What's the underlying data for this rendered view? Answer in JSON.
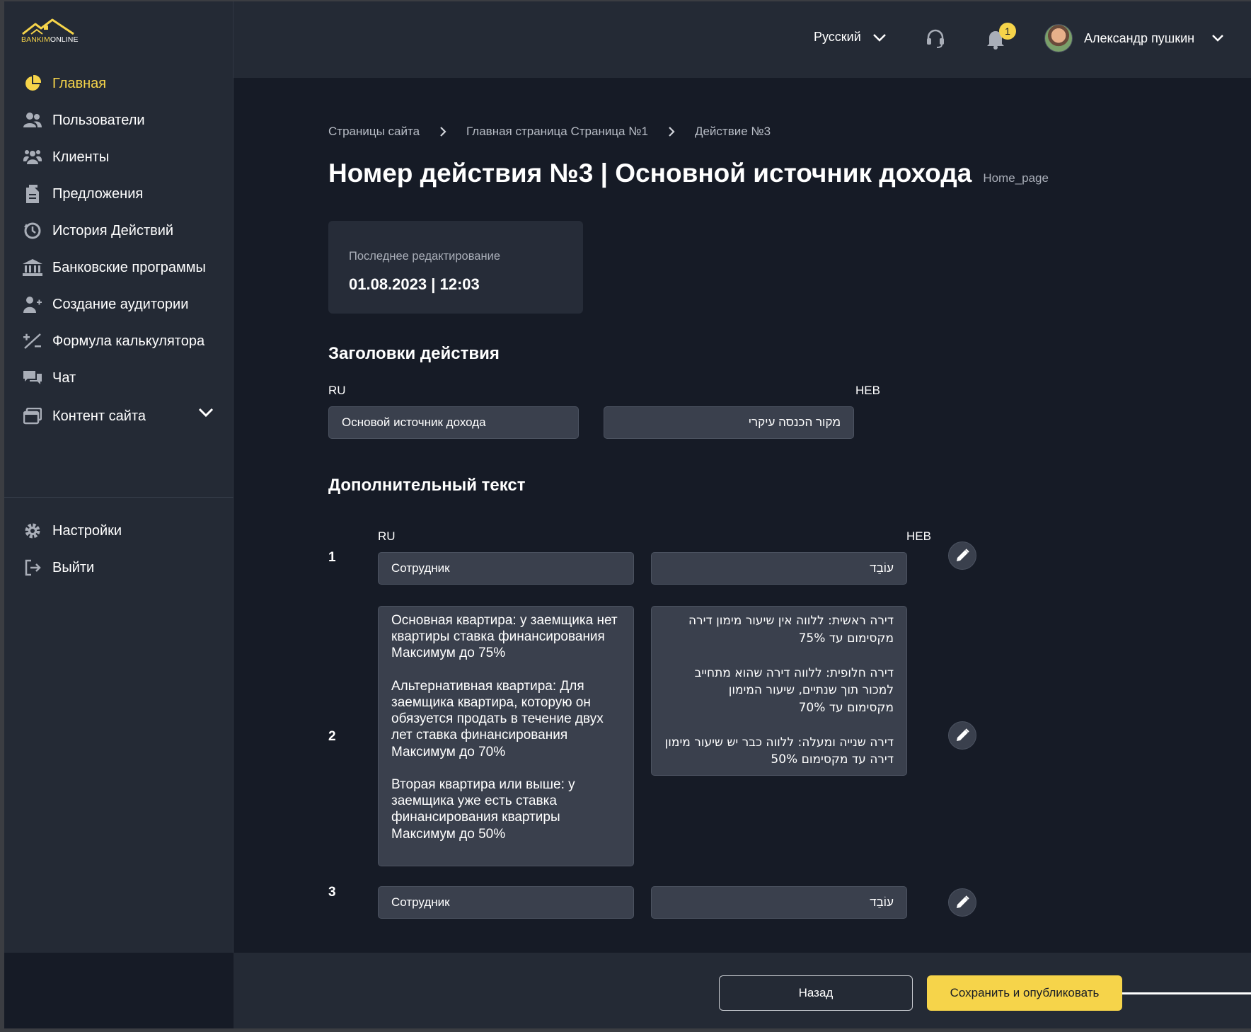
{
  "brand": {
    "logo_text_a": "BANKIM",
    "logo_text_b": "ONLINE"
  },
  "sidebar": {
    "items": [
      {
        "label": "Главная",
        "icon": "pie-chart-icon",
        "active": true
      },
      {
        "label": "Пользователи",
        "icon": "users-icon"
      },
      {
        "label": "Клиенты",
        "icon": "clients-icon"
      },
      {
        "label": "Предложения",
        "icon": "document-icon"
      },
      {
        "label": "История Действий",
        "icon": "history-icon"
      },
      {
        "label": "Банковские программы",
        "icon": "bank-icon"
      },
      {
        "label": "Создание аудитории",
        "icon": "add-user-icon"
      },
      {
        "label": "Формула калькулятора",
        "icon": "formula-icon"
      },
      {
        "label": "Чат",
        "icon": "chat-icon"
      },
      {
        "label": "Контент сайта",
        "icon": "content-icon"
      }
    ],
    "bottom": [
      {
        "label": "Настройки",
        "icon": "gear-icon"
      },
      {
        "label": "Выйти",
        "icon": "logout-icon"
      }
    ]
  },
  "topbar": {
    "language": "Русский",
    "notifications_count": "1",
    "user_name": "Александр пушкин"
  },
  "breadcrumb": [
    "Страницы сайта",
    "Главная страница Страница  №1",
    "Действие №3"
  ],
  "page": {
    "title": "Номер действия №3 | Основной источник дохода",
    "slug": "Home_page"
  },
  "last_edit": {
    "caption": "Последнее редактирование",
    "value": "01.08.2023 | 12:03"
  },
  "headings_section": {
    "title": "Заголовки действия",
    "ru_label": "RU",
    "heb_label": "HEB",
    "ru_value": "Основой источник дохода",
    "heb_value": "מקור הכנסה עיקרי"
  },
  "extra_section": {
    "title": "Дополнительный  текст",
    "ru_label": "RU",
    "heb_label": "HEB",
    "rows": [
      {
        "num": "1",
        "ru": "Сотрудник",
        "heb": "עוֹבֵד"
      },
      {
        "num": "2",
        "ru": "Основная квартира: у заемщика нет квартиры ставка финансирования\nМаксимум до 75%\n\nАльтернативная квартира: Для заемщика квартира, которую он обязуется продать в течение двух лет ставка финансирования\nМаксимум до 70%\n\nВторая квартира или выше: у заемщика уже есть ставка финансирования квартиры\nМаксимум до 50%",
        "heb": "דירה ראשית: ללווה אין שיעור מימון דירה\nמקסימום עד 75%\n\nדירה חלופית: ללווה דירה שהוא מתחייב\nלמכור תוך שנתיים, שיעור המימון\nמקסימום עד 70%\n\nדירה שנייה ומעלה: ללווה כבר יש שיעור מימון\nדירה עד מקסימום 50%"
      },
      {
        "num": "3",
        "ru": "Сотрудник",
        "heb": "עוֹבֵד"
      }
    ]
  },
  "footer": {
    "back_label": "Назад",
    "save_label": "Сохранить и опубликовать"
  },
  "colors": {
    "accent": "#f6d44a",
    "sidebar": "#242a35",
    "background": "#161b26",
    "field": "#3a404d"
  }
}
